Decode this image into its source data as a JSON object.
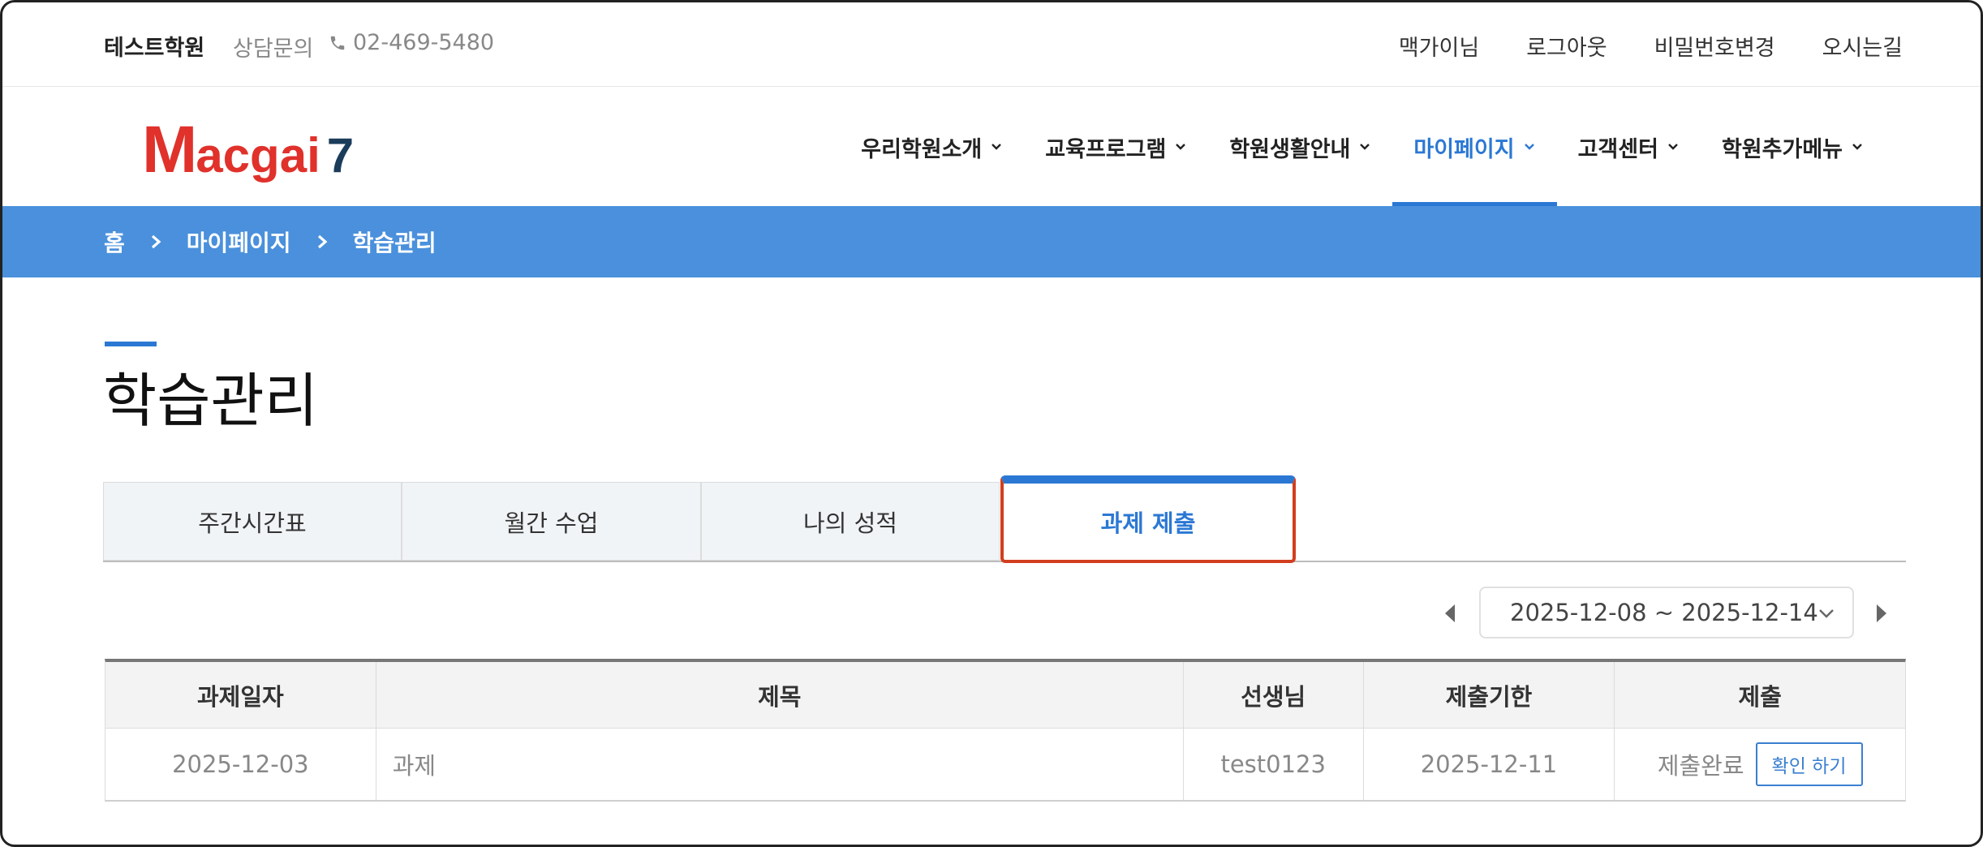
{
  "topbar": {
    "brand": "테스트학원",
    "consult_label": "상담문의",
    "phone": "02-469-5480",
    "links": [
      "맥가이님",
      "로그아웃",
      "비밀번호변경",
      "오시는길"
    ]
  },
  "logo": {
    "m": "M",
    "rest": "acgai",
    "seven": "7"
  },
  "menu": [
    {
      "label": "우리학원소개"
    },
    {
      "label": "교육프로그램"
    },
    {
      "label": "학원생활안내"
    },
    {
      "label": "마이페이지",
      "active": true
    },
    {
      "label": "고객센터"
    },
    {
      "label": "학원추가메뉴"
    }
  ],
  "breadcrumb": [
    "홈",
    "마이페이지",
    "학습관리"
  ],
  "page_title": "학습관리",
  "tabs": [
    {
      "label": "주간시간표"
    },
    {
      "label": "월간 수업"
    },
    {
      "label": "나의 성적"
    },
    {
      "label": "과제 제출",
      "active": true
    }
  ],
  "date_range": "2025-12-08 ~ 2025-12-14",
  "table": {
    "headers": [
      "과제일자",
      "제목",
      "선생님",
      "제출기한",
      "제출"
    ],
    "rows": [
      {
        "date": "2025-12-03",
        "title": "과제",
        "teacher": "test0123",
        "deadline": "2025-12-11",
        "status": "제출완료",
        "action": "확인 하기"
      }
    ]
  },
  "colors": {
    "accent": "#2b78d4",
    "breadcrumb_bg": "#4a90dc",
    "logo_red": "#e0312b",
    "logo_navy": "#1b3c5a",
    "highlight": "#d23e1e"
  }
}
